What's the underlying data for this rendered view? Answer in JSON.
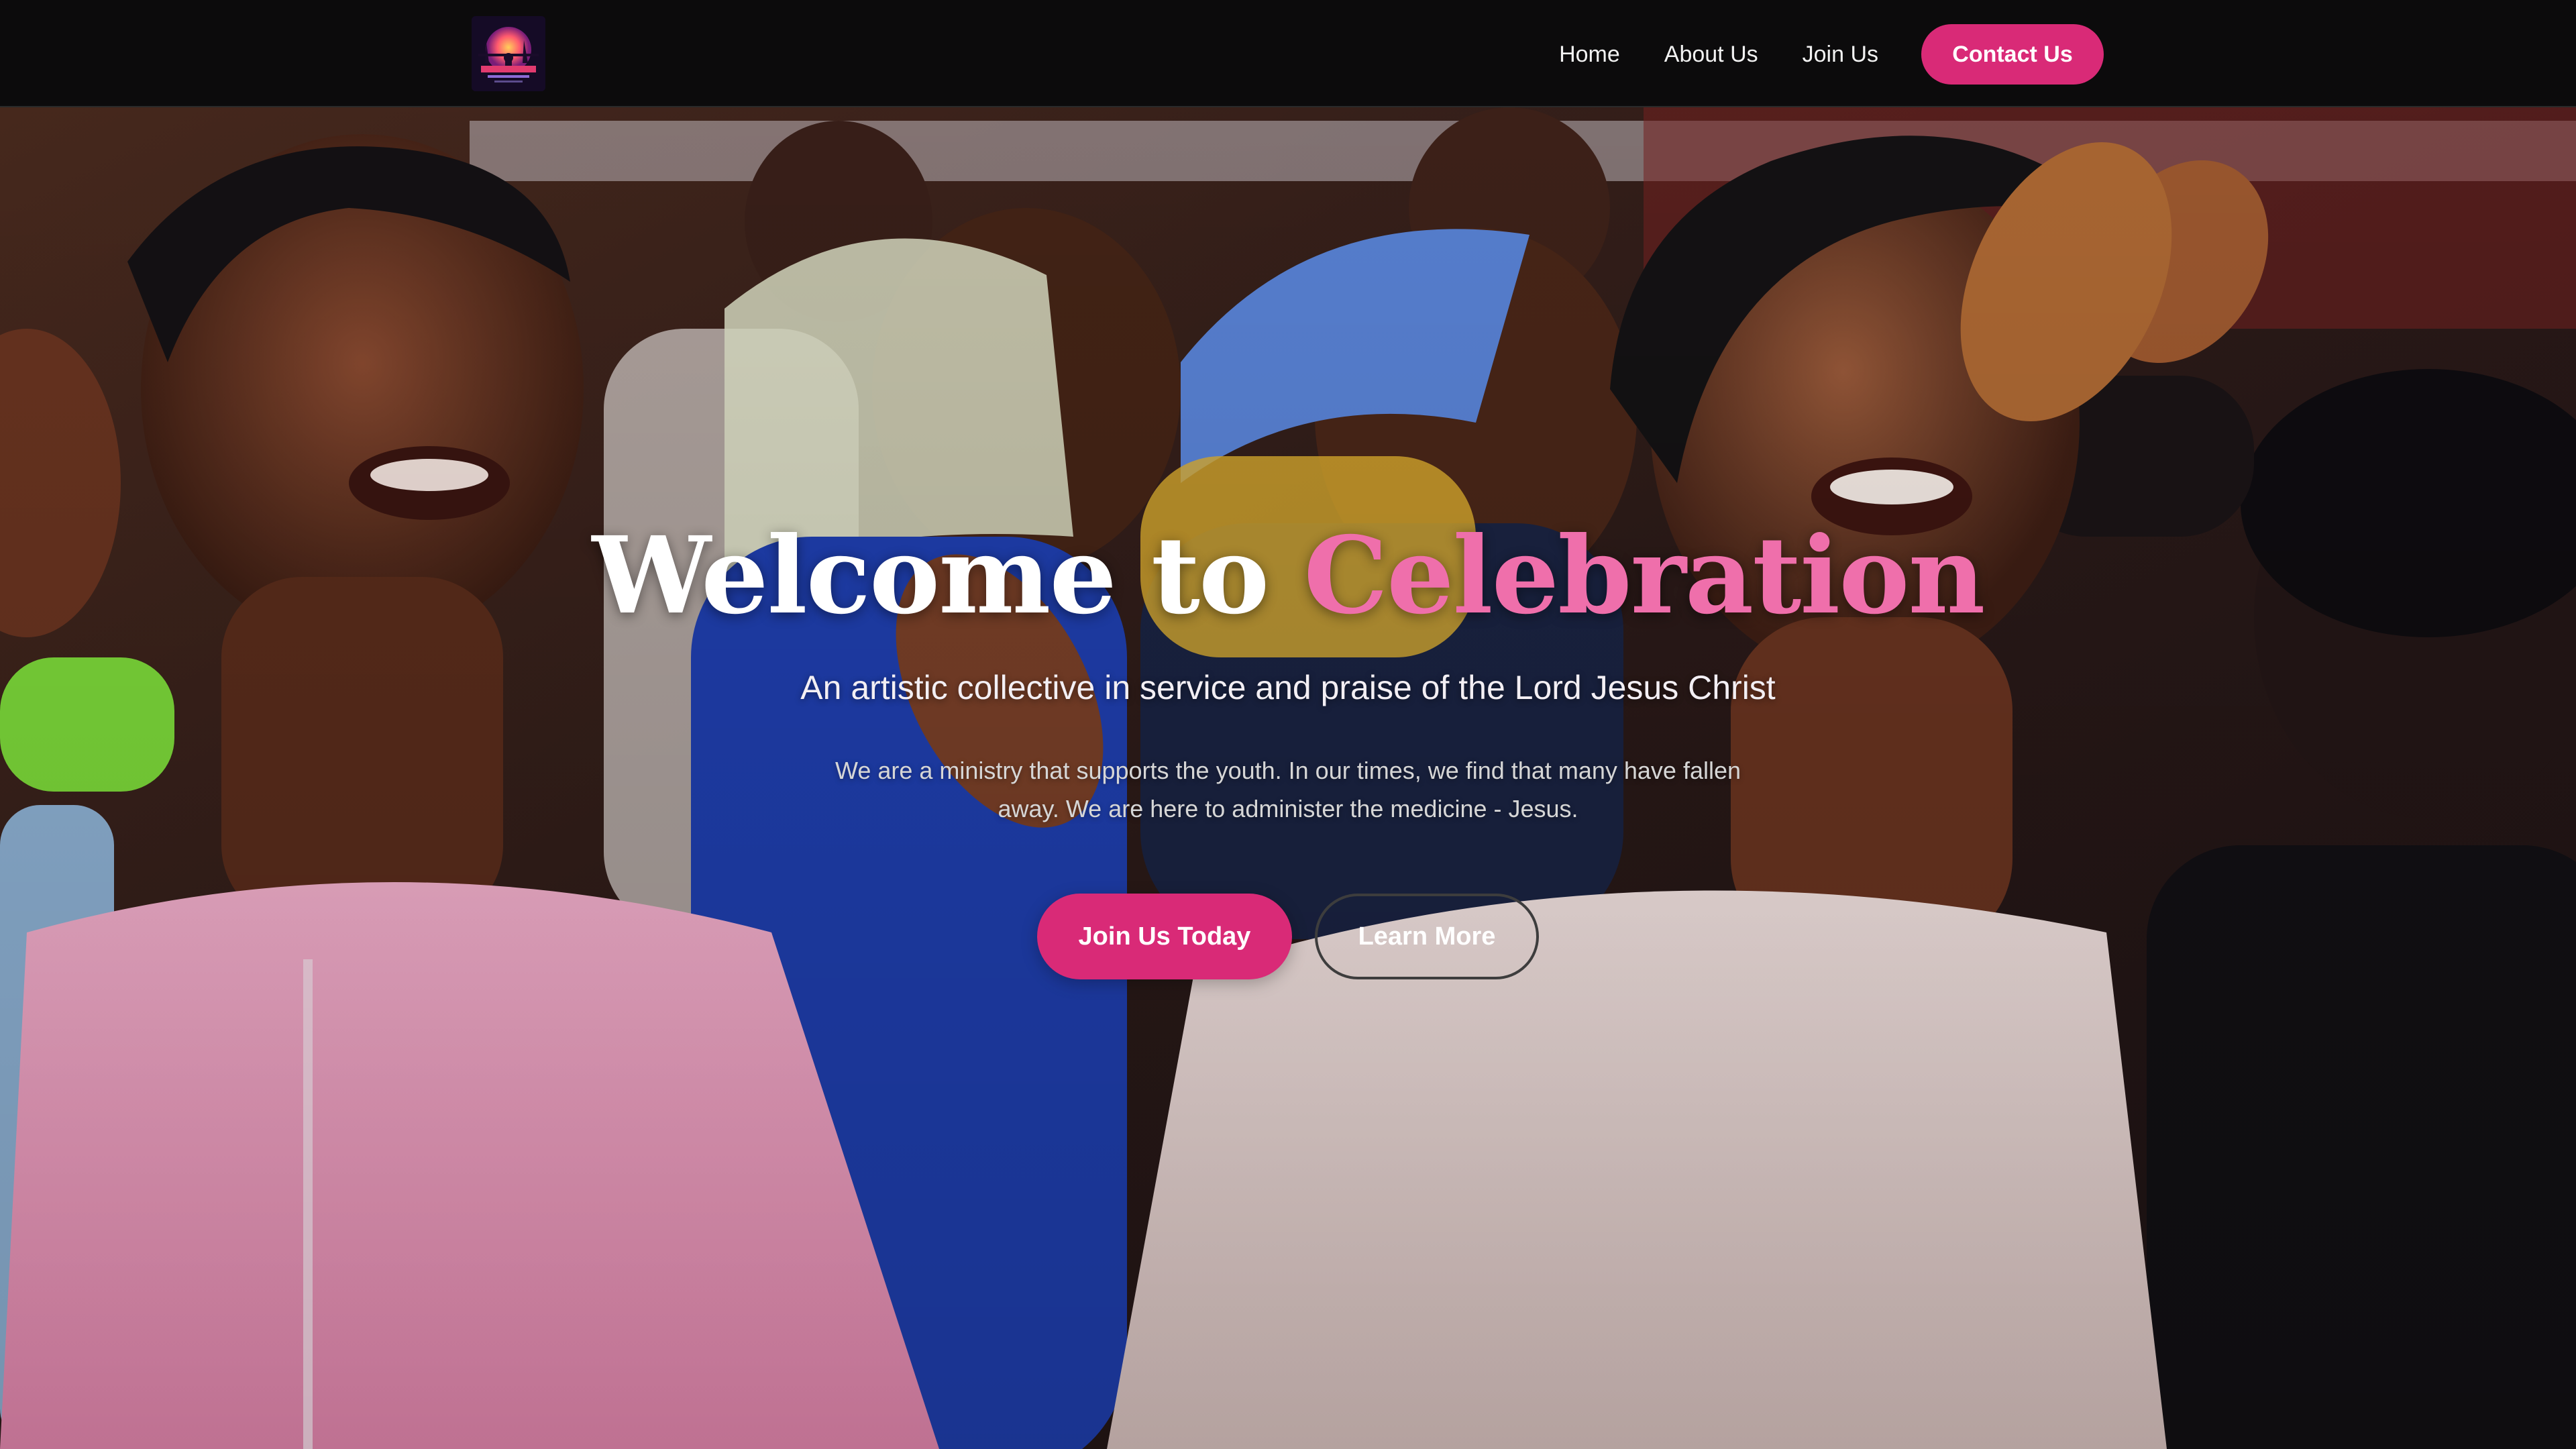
{
  "header": {
    "logo_icon": "celebration-logo",
    "nav": [
      {
        "label": "Home"
      },
      {
        "label": "About Us"
      },
      {
        "label": "Join Us"
      }
    ],
    "contact_label": "Contact Us"
  },
  "hero": {
    "background": "worship-crowd-photo",
    "title_prefix": "Welcome to ",
    "title_accent": "Celebration",
    "subtitle": "An artistic collective in service and praise of the Lord Jesus Christ",
    "description": "We are a ministry that supports the youth. In our times, we find that many have fallen away. We are here to administer the medicine - Jesus.",
    "primary_button": "Join Us Today",
    "secondary_button": "Learn More"
  },
  "colors": {
    "accent": "#d92a77",
    "title_accent": "#ef6fab",
    "header_bg": "#0c0b0c"
  }
}
